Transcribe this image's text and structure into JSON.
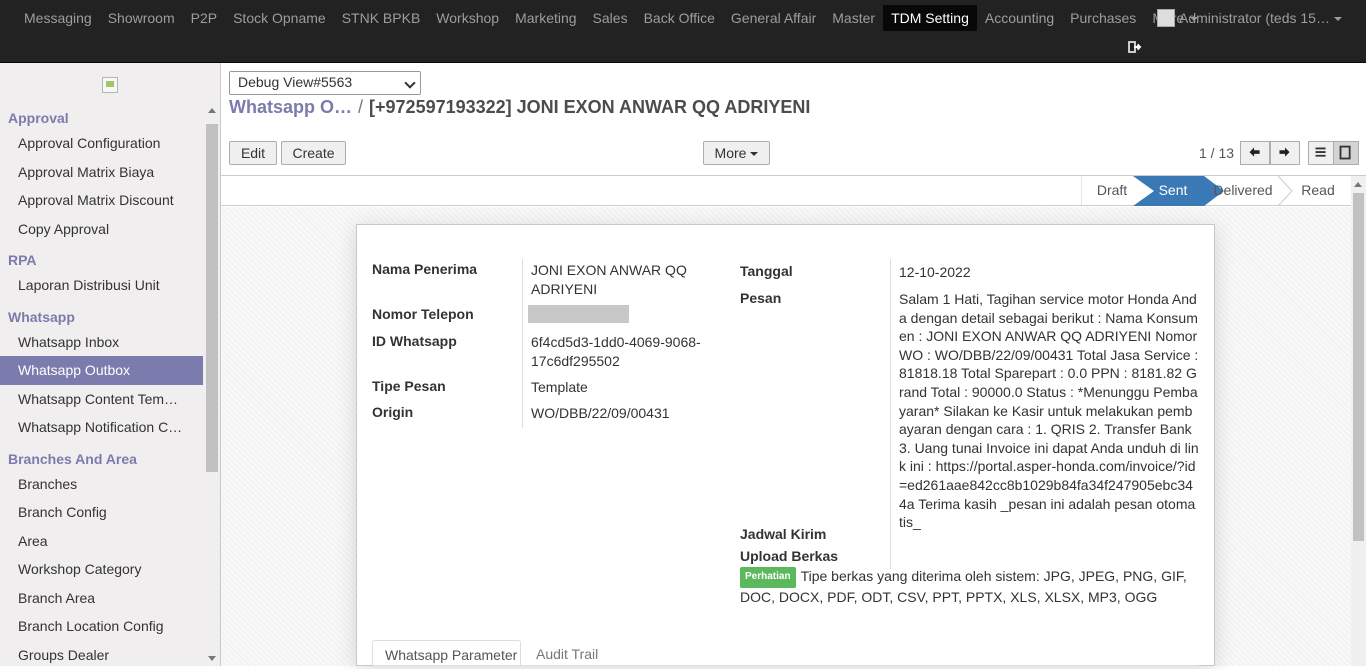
{
  "topnav": {
    "items": [
      "Messaging",
      "Showroom",
      "P2P",
      "Stock Opname",
      "STNK BPKB",
      "Workshop",
      "Marketing",
      "Sales",
      "Back Office",
      "General Affair",
      "Master",
      "TDM Setting",
      "Accounting",
      "Purchases"
    ],
    "active": "TDM Setting",
    "more_label": "More",
    "user_label": "Administrator (teds   15…"
  },
  "sidebar": {
    "sections": [
      {
        "title": "Approval",
        "items": [
          "Approval Configuration",
          "Approval Matrix Biaya",
          "Approval Matrix Discount",
          "Copy Approval"
        ]
      },
      {
        "title": "RPA",
        "items": [
          "Laporan Distribusi Unit"
        ]
      },
      {
        "title": "Whatsapp",
        "items": [
          "Whatsapp Inbox",
          "Whatsapp Outbox",
          "Whatsapp Content Tem…",
          "Whatsapp Notification C…"
        ]
      },
      {
        "title": "Branches And Area",
        "items": [
          "Branches",
          "Branch Config",
          "Area",
          "Workshop Category",
          "Branch Area",
          "Branch Location Config",
          "Groups Dealer"
        ]
      }
    ],
    "active_item": "Whatsapp Outbox"
  },
  "control": {
    "debug_select": "Debug View#5563",
    "breadcrumb_parent": "Whatsapp O…",
    "breadcrumb_sep": "/",
    "breadcrumb_current": "[+972597193322] JONI EXON ANWAR QQ ADRIYENI",
    "edit_label": "Edit",
    "create_label": "Create",
    "more_label": "More",
    "pager": "1 / 13"
  },
  "statusbar": {
    "stages": [
      "Draft",
      "Sent",
      "Delivered",
      "Read"
    ],
    "current": "Sent"
  },
  "form": {
    "nama_penerima_label": "Nama Penerima",
    "nama_penerima_value": "JONI EXON ANWAR QQ ADRIYENI",
    "nomor_telepon_label": "Nomor Telepon",
    "id_whatsapp_label": "ID Whatsapp",
    "id_whatsapp_value": "6f4cd5d3-1dd0-4069-9068-17c6df295502",
    "tipe_pesan_label": "Tipe Pesan",
    "tipe_pesan_value": "Template",
    "origin_label": "Origin",
    "origin_value": "WO/DBB/22/09/00431",
    "tanggal_label": "Tanggal",
    "tanggal_value": "12-10-2022",
    "pesan_label": "Pesan",
    "pesan_value": "Salam 1 Hati, Tagihan service motor Honda Anda dengan detail sebagai berikut : Nama Konsumen : JONI EXON ANWAR QQ ADRIYENI Nomor WO : WO/DBB/22/09/00431 Total Jasa Service : 81818.18 Total Sparepart : 0.0 PPN : 8181.82 Grand Total : 90000.0 Status : *Menunggu Pembayaran* Silakan ke Kasir untuk melakukan pembayaran dengan cara : 1. QRIS 2. Transfer Bank 3. Uang tunai Invoice ini dapat Anda unduh di link ini : https://portal.asper-honda.com/invoice/?id=ed261aae842cc8b1029b84fa34f247905ebc344a Terima kasih _pesan ini adalah pesan otomatis_",
    "jadwal_kirim_label": "Jadwal Kirim",
    "upload_berkas_label": "Upload Berkas",
    "badge": "Perhatian",
    "upload_note": "Tipe berkas yang diterima oleh sistem: JPG, JPEG, PNG, GIF, DOC, DOCX, PDF, ODT, CSV, PPT, PPTX, XLS, XLSX, MP3, OGG"
  },
  "tabs": [
    "Whatsapp Parameter",
    "Audit Trail"
  ],
  "colors": {
    "navbar": "#222222",
    "accent": "#7c7bad",
    "status_active": "#3a79b6",
    "badge": "#5cb85c"
  }
}
